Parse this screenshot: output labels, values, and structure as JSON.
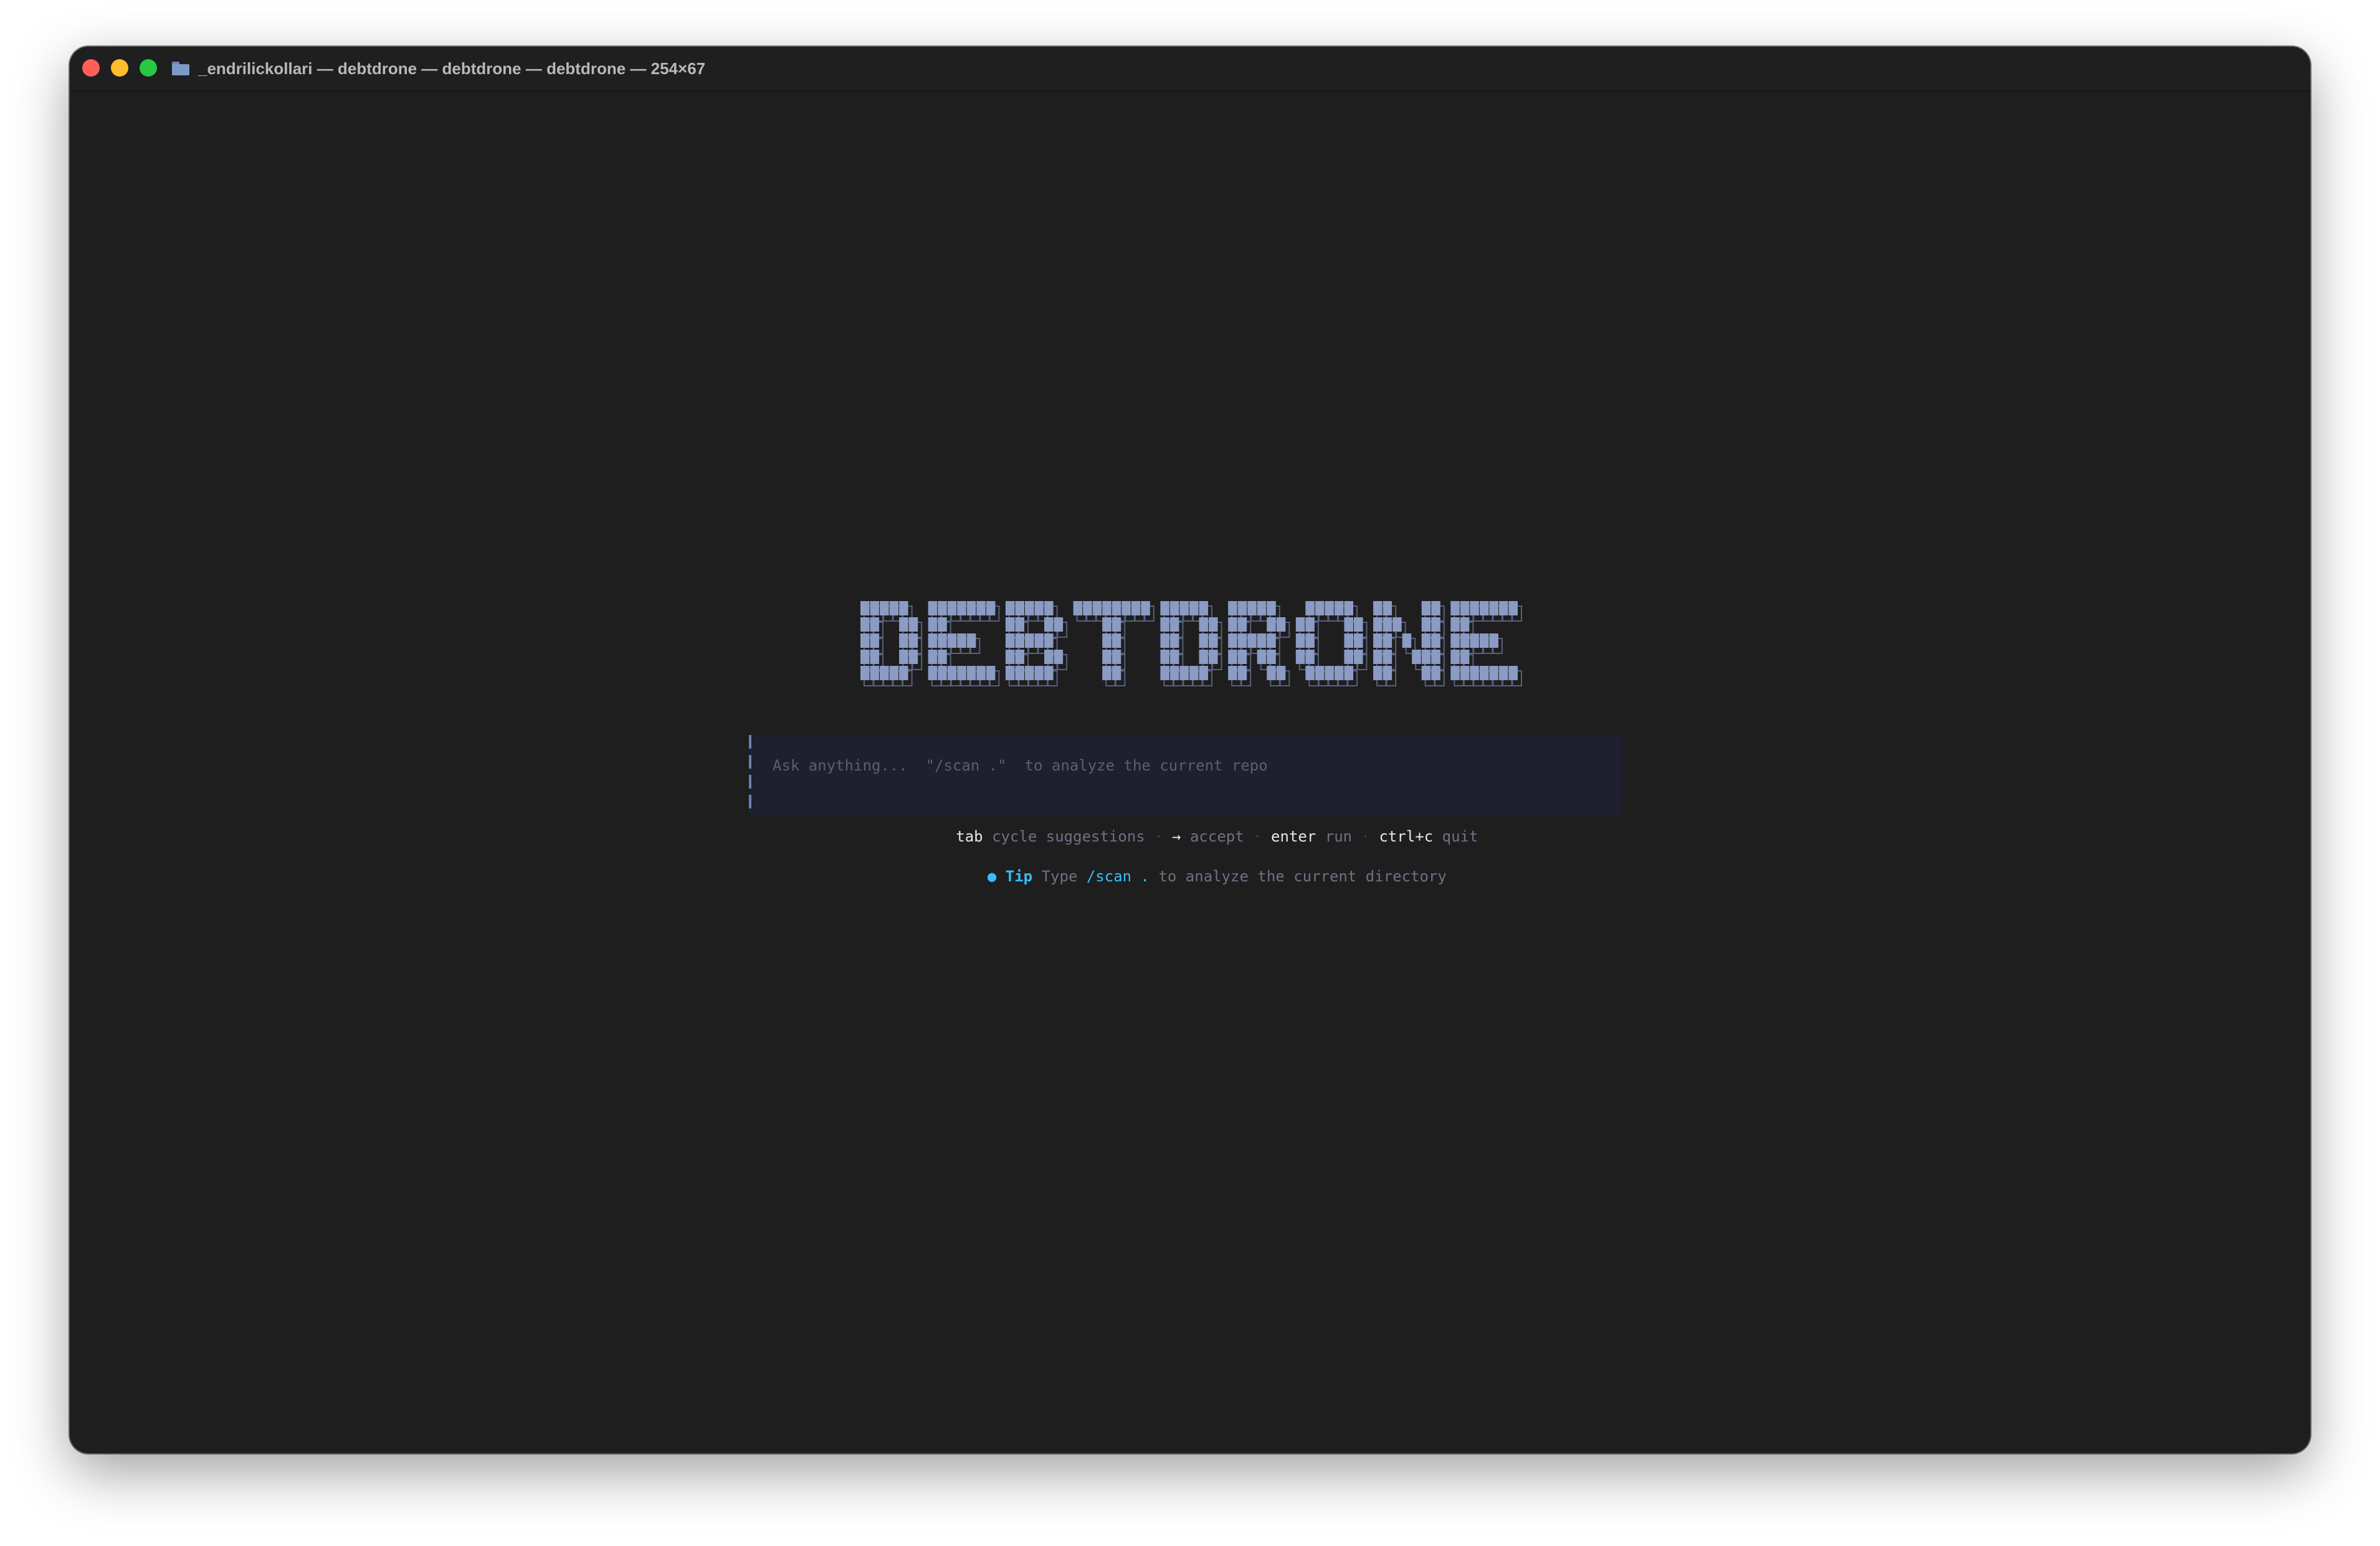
{
  "window": {
    "title": "_endrilickollari — debtdrone — debtdrone — debtdrone — 254×67",
    "buttons": [
      "close",
      "minimize",
      "zoom"
    ]
  },
  "logo": {
    "text": "DEBTDRONE",
    "fill_color": "#8b9bc4",
    "shadow_color": "#56607e"
  },
  "prompt": {
    "placeholder": "Ask anything...  \"/scan .\"  to analyze the current repo"
  },
  "hints": [
    {
      "key": "tab",
      "action": "cycle suggestions"
    },
    {
      "key": "→",
      "action": "accept"
    },
    {
      "key": "enter",
      "action": "run"
    },
    {
      "key": "ctrl+c",
      "action": "quit"
    }
  ],
  "hint_separator": "·",
  "tip": {
    "bullet": "●",
    "label": "Tip",
    "before": "Type",
    "command": "/scan .",
    "after": "to analyze the current directory"
  },
  "colors": {
    "background": "#1e1e1e",
    "accent": "#38bdf8",
    "input_bg": "#1e2030"
  }
}
